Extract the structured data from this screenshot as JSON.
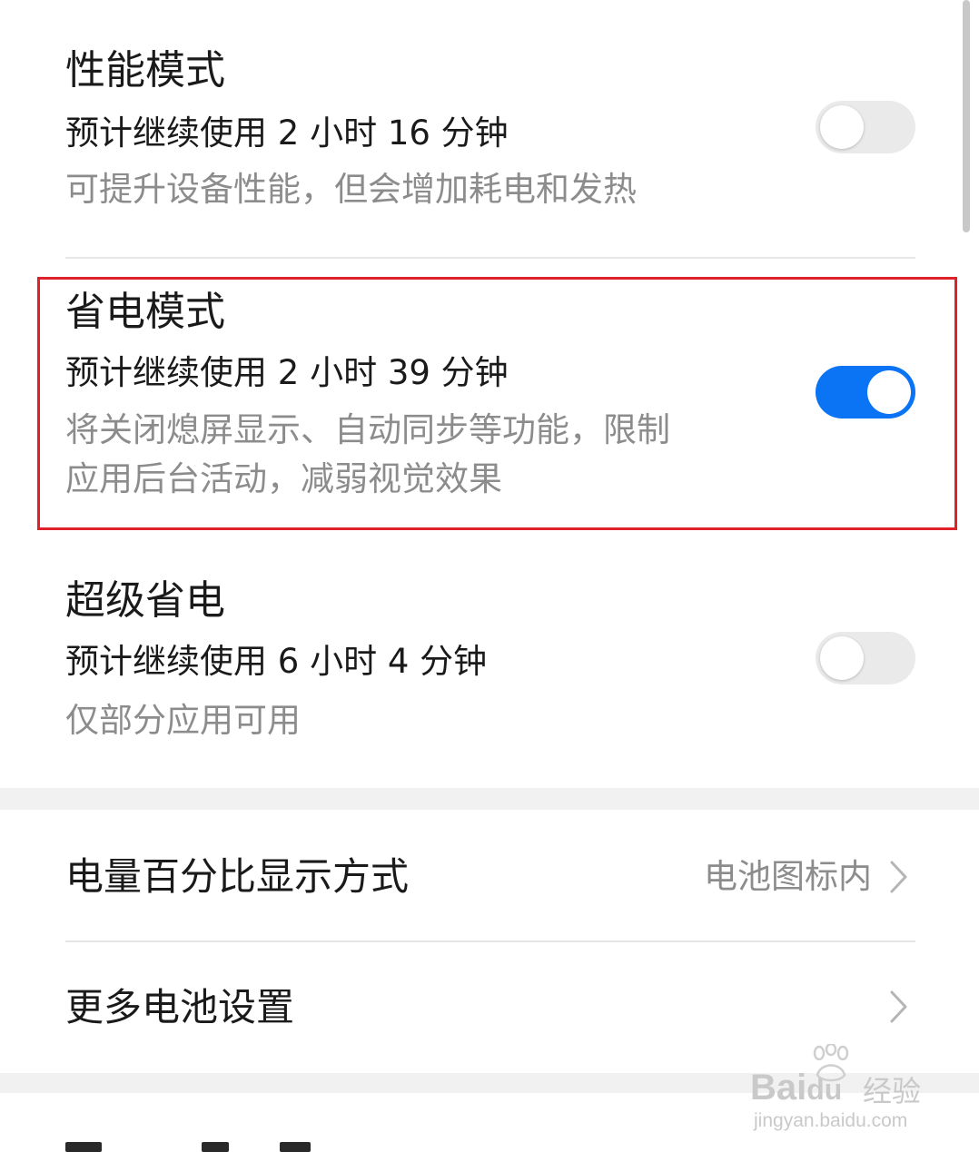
{
  "performance_mode": {
    "title": "性能模式",
    "estimate": "预计继续使用 2 小时 16 分钟",
    "description": "可提升设备性能，但会增加耗电和发热",
    "enabled": false
  },
  "power_saving_mode": {
    "title": "省电模式",
    "estimate": "预计继续使用 2 小时 39 分钟",
    "description_line1": "将关闭熄屏显示、自动同步等功能，限制",
    "description_line2": "应用后台活动，减弱视觉效果",
    "enabled": true
  },
  "ultra_power_saving": {
    "title": "超级省电",
    "estimate": "预计继续使用 6 小时 4 分钟",
    "description": "仅部分应用可用",
    "enabled": false
  },
  "battery_percentage": {
    "label": "电量百分比显示方式",
    "value": "电池图标内"
  },
  "more_settings": {
    "label": "更多电池设置"
  },
  "watermark": {
    "brand": "Bai",
    "brand_tail": "经验",
    "url": "jingyan.baidu.com"
  },
  "colors": {
    "toggle_on": "#0a74f4",
    "highlight_border": "#e0202a"
  },
  "icons": {
    "chevron": "chevron-right-icon",
    "paw": "paw-icon"
  }
}
